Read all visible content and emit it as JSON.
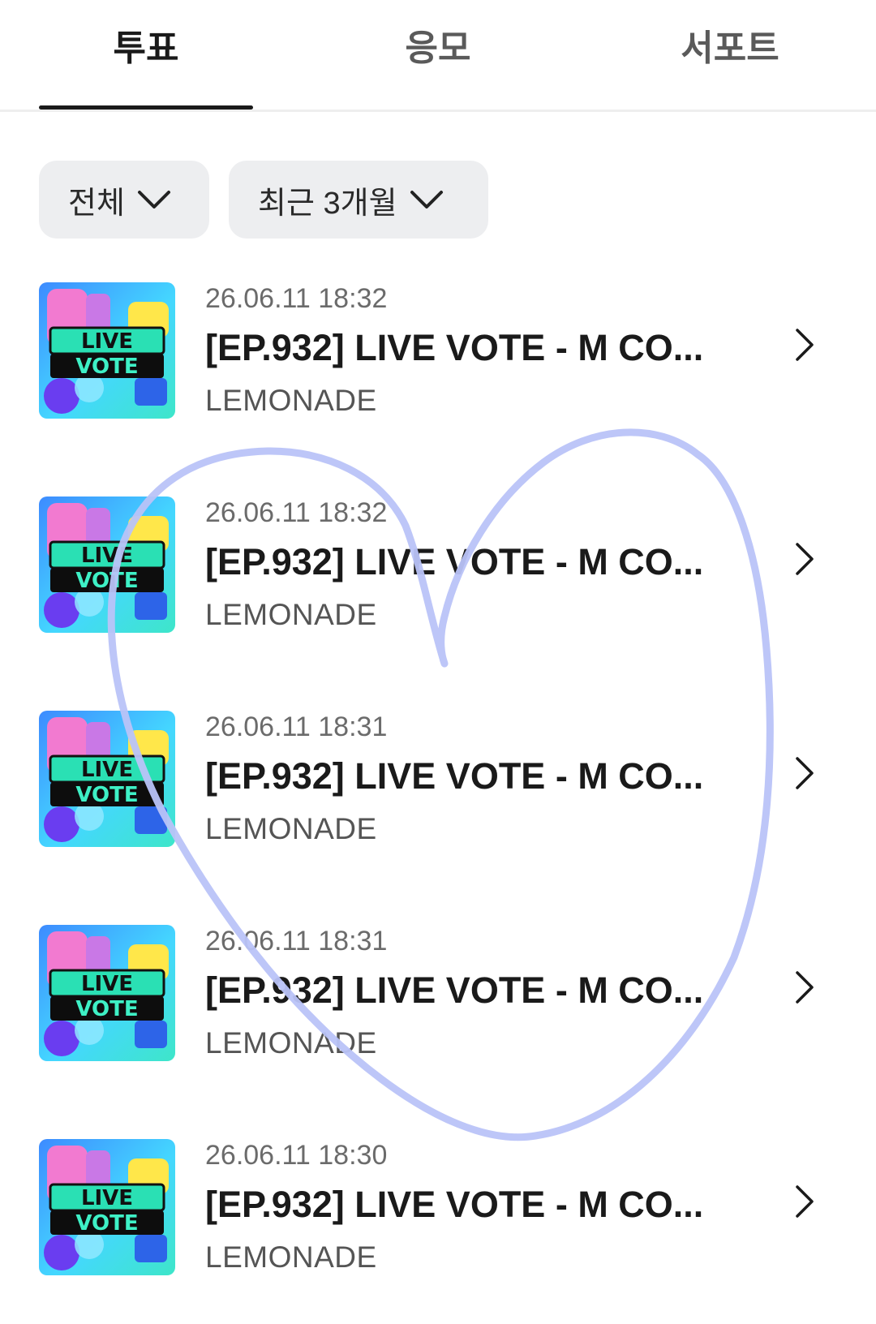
{
  "tabs": [
    {
      "label": "투표",
      "active": true
    },
    {
      "label": "응모",
      "active": false
    },
    {
      "label": "서포트",
      "active": false
    }
  ],
  "filters": [
    {
      "label": "전체"
    },
    {
      "label": "최근 3개월"
    }
  ],
  "items": [
    {
      "date": "26.06.11 18:32",
      "title": "[EP.932] LIVE VOTE - M CO...",
      "artist": "LEMONADE",
      "thumb_text": [
        "LIVE",
        "VOTE"
      ]
    },
    {
      "date": "26.06.11 18:32",
      "title": "[EP.932] LIVE VOTE - M CO...",
      "artist": "LEMONADE",
      "thumb_text": [
        "LIVE",
        "VOTE"
      ]
    },
    {
      "date": "26.06.11 18:31",
      "title": "[EP.932] LIVE VOTE - M CO...",
      "artist": "LEMONADE",
      "thumb_text": [
        "LIVE",
        "VOTE"
      ]
    },
    {
      "date": "26.06.11 18:31",
      "title": "[EP.932] LIVE VOTE - M CO...",
      "artist": "LEMONADE",
      "thumb_text": [
        "LIVE",
        "VOTE"
      ]
    },
    {
      "date": "26.06.11 18:30",
      "title": "[EP.932] LIVE VOTE - M CO...",
      "artist": "LEMONADE",
      "thumb_text": [
        "LIVE",
        "VOTE"
      ]
    }
  ],
  "colors": {
    "heart_stroke": "#b9c3f8",
    "tab_active": "#1a1a1a",
    "filter_bg": "#edeef0",
    "thumb_teal": "#3ee6c9",
    "thumb_blue": "#3d8bff",
    "thumb_yellow": "#ffe74a",
    "thumb_pink": "#f27ad0"
  },
  "icons": {
    "filter_chevron": "chevron-down-icon",
    "row_arrow": "chevron-right-icon"
  }
}
